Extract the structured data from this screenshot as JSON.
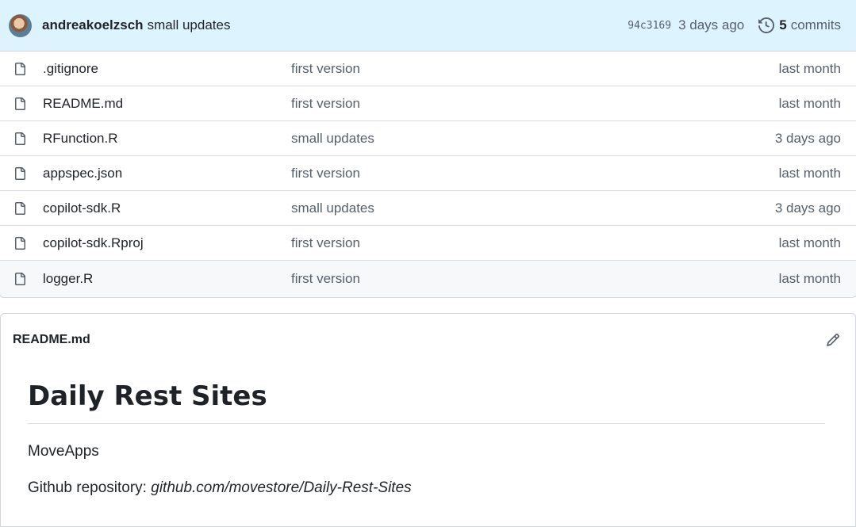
{
  "commit": {
    "author": "andreakoelzsch",
    "message": "small updates",
    "sha": "94c3169",
    "time": "3 days ago",
    "commit_count": "5",
    "commits_label": "commits"
  },
  "files": [
    {
      "name": ".gitignore",
      "message": "first version",
      "date": "last month"
    },
    {
      "name": "README.md",
      "message": "first version",
      "date": "last month"
    },
    {
      "name": "RFunction.R",
      "message": "small updates",
      "date": "3 days ago"
    },
    {
      "name": "appspec.json",
      "message": "first version",
      "date": "last month"
    },
    {
      "name": "copilot-sdk.R",
      "message": "small updates",
      "date": "3 days ago"
    },
    {
      "name": "copilot-sdk.Rproj",
      "message": "first version",
      "date": "last month"
    },
    {
      "name": "logger.R",
      "message": "first version",
      "date": "last month"
    }
  ],
  "readme": {
    "filename": "README.md",
    "title": "Daily Rest Sites",
    "line1": "MoveApps",
    "repo_label": "Github repository: ",
    "repo_link": "github.com/movestore/Daily-Rest-Sites"
  },
  "icons": {
    "file": "file-icon",
    "history": "history-icon",
    "edit": "pencil-icon"
  }
}
